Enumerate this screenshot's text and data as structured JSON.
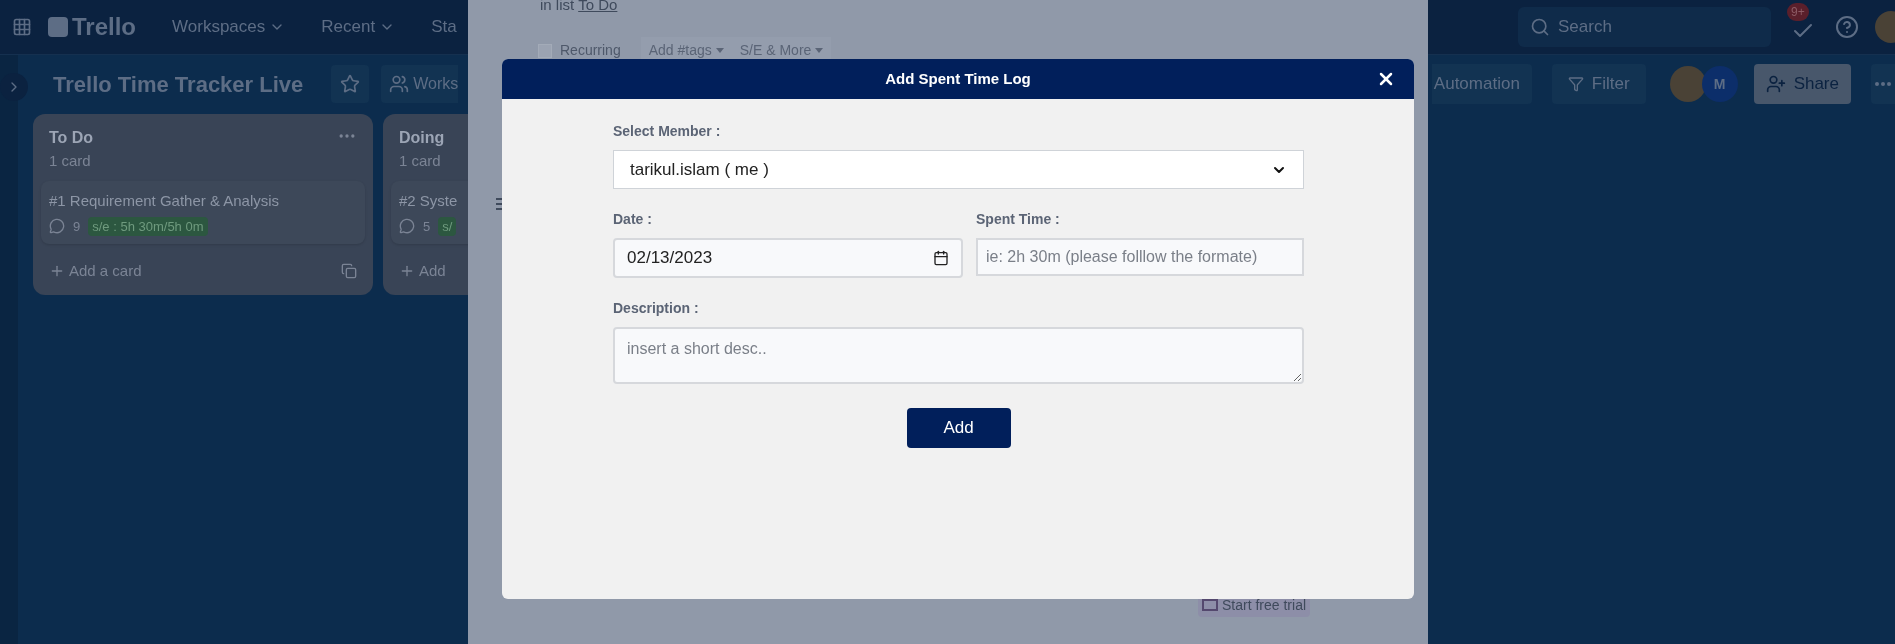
{
  "header": {
    "logo": "Trello",
    "nav": [
      "Workspaces",
      "Recent",
      "Sta"
    ],
    "search": {
      "placeholder": "Search"
    },
    "notification_badge": "9+"
  },
  "board": {
    "title": "Trello Time Tracker Live",
    "workspace_button": "Works",
    "automation": "Automation",
    "filter": "Filter",
    "member_initial": "M",
    "share": "Share"
  },
  "lists": [
    {
      "title": "To Do",
      "count": "1 card",
      "cards": [
        {
          "title": "#1 Requirement Gather & Analysis",
          "comments": "9",
          "badge": "s/e : 5h 30m/5h 0m"
        }
      ],
      "add_card": "Add a card"
    },
    {
      "title": "Doing",
      "count": "1 card",
      "cards": [
        {
          "title": "#2 Syste",
          "comments": "5",
          "badge": "s/"
        }
      ],
      "add_card": "Add"
    }
  ],
  "card_detail": {
    "list_prefix": "in list",
    "list_link": "To Do",
    "recurring": {
      "label": "Recurring",
      "checked": false
    },
    "buttons": [
      "Add #tags",
      "S/E & More"
    ],
    "trial": "Start free trial"
  },
  "modal": {
    "title": "Add Spent Time Log",
    "member": {
      "label": "Select Member :",
      "value": "tarikul.islam ( me )"
    },
    "date": {
      "label": "Date :",
      "value": "02/13/2023"
    },
    "spent_time": {
      "label": "Spent Time :",
      "placeholder": "ie: 2h 30m (please folllow the formate)"
    },
    "description": {
      "label": "Description :",
      "placeholder": "insert a short desc.."
    },
    "button": "Add"
  }
}
